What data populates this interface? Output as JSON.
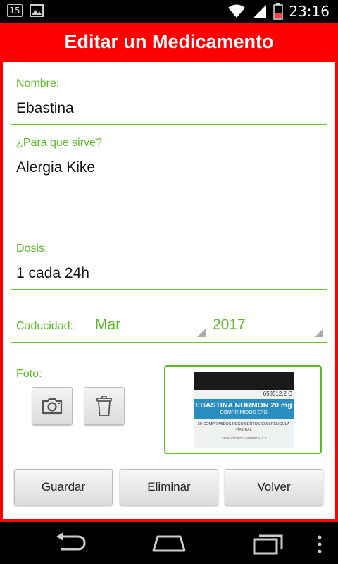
{
  "status_bar": {
    "notification_badge": "15",
    "time": "23:16"
  },
  "header": {
    "title": "Editar un Medicamento"
  },
  "form": {
    "nombre_label": "Nombre:",
    "nombre_value": "Ebastina",
    "para_label": "¿Para que sirve?",
    "para_value": "Alergia Kike",
    "dosis_label": "Dosis:",
    "dosis_value": "1 cada 24h",
    "caducidad_label": "Caducidad:",
    "caducidad_month": "Mar",
    "caducidad_year": "2017",
    "foto_label": "Foto:"
  },
  "photo": {
    "code": "658512.2 C",
    "brand": "EBASTINA NORMON 20 mg",
    "sub": "COMPRIMIDOS EFG",
    "line1": "20 COMPRIMIDOS RECUBIERTOS CON PELICULA",
    "line2": "VÍA ORAL",
    "line3": "LABORATORIOS NORMON, S.A."
  },
  "buttons": {
    "guardar": "Guardar",
    "eliminar": "Eliminar",
    "volver": "Volver"
  },
  "colors": {
    "accent_red": "#ff0000",
    "accent_green": "#5fba2a"
  }
}
